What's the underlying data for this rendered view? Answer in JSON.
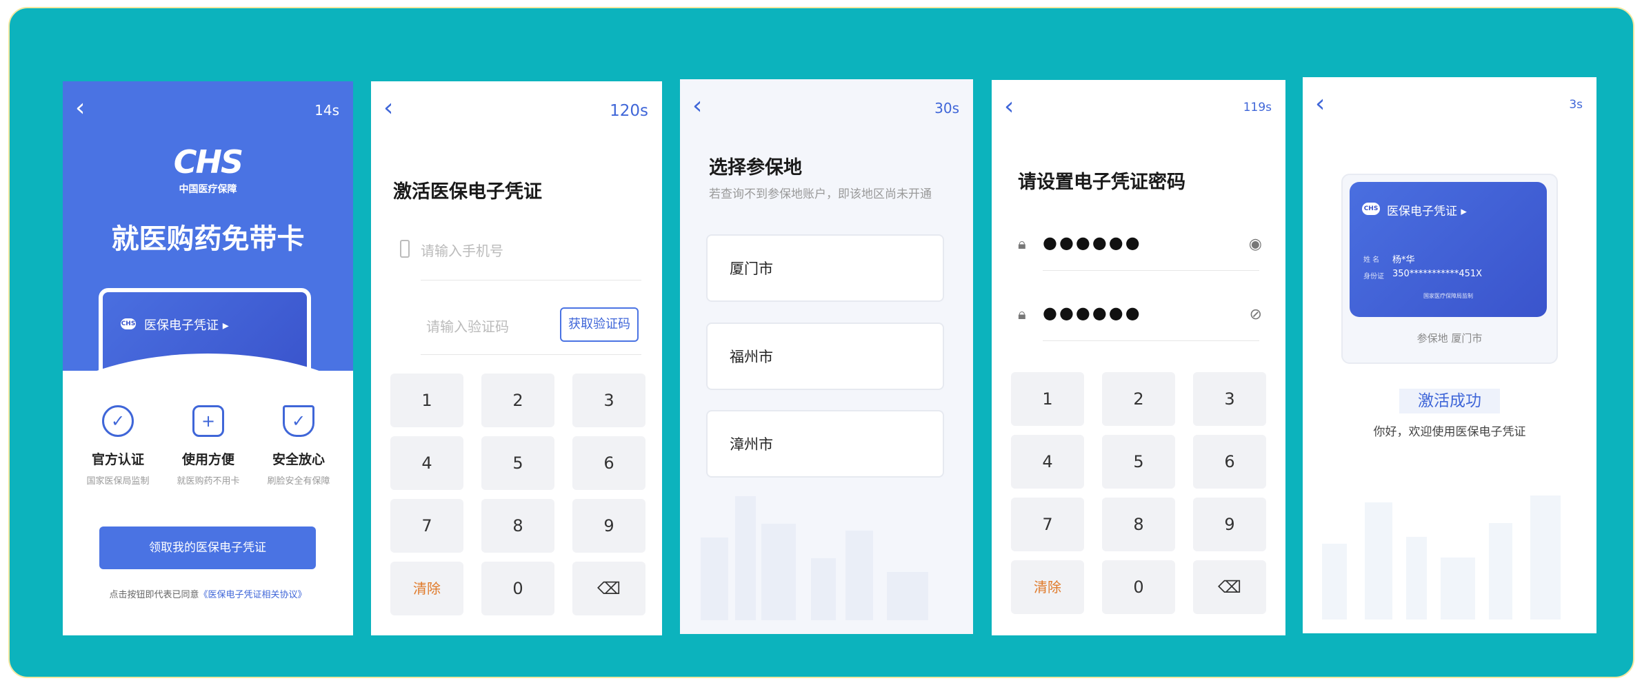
{
  "s1": {
    "timer": "14s",
    "logo_big": "CHS",
    "logo_small": "中国医疗保障",
    "headline": "就医购药免带卡",
    "card_label": "医保电子凭证 ▸",
    "features": [
      {
        "icon": "badge-icon",
        "title": "官方认证",
        "desc": "国家医保局监制"
      },
      {
        "icon": "medkit-icon",
        "title": "使用方便",
        "desc": "就医购药不用卡"
      },
      {
        "icon": "shield-check-icon",
        "title": "安全放心",
        "desc": "刷脸安全有保障"
      }
    ],
    "button": "领取我的医保电子凭证",
    "agree_prefix": "点击按钮即代表已同意",
    "agree_link": "《医保电子凭证相关协议》"
  },
  "s2": {
    "timer": "120s",
    "title": "激活医保电子凭证",
    "phone_placeholder": "请输入手机号",
    "code_placeholder": "请输入验证码",
    "get_code": "获取验证码",
    "keys": [
      "1",
      "2",
      "3",
      "4",
      "5",
      "6",
      "7",
      "8",
      "9",
      "清除",
      "0",
      "⌫"
    ]
  },
  "s3": {
    "timer": "30s",
    "title": "选择参保地",
    "subtitle": "若查询不到参保地账户，即该地区尚未开通",
    "cities": [
      "厦门市",
      "福州市",
      "漳州市"
    ]
  },
  "s4": {
    "timer": "119s",
    "title": "请设置电子凭证密码",
    "pwd1": "●●●●●●",
    "pwd2": "●●●●●●",
    "keys": [
      "1",
      "2",
      "3",
      "4",
      "5",
      "6",
      "7",
      "8",
      "9",
      "清除",
      "0",
      "⌫"
    ]
  },
  "s5": {
    "timer": "3s",
    "card_title": "医保电子凭证 ▸",
    "name_label": "姓 名",
    "name_value": "杨*华",
    "id_label": "身份证",
    "id_value": "350***********451X",
    "card_footer": "国家医疗保障局监制",
    "insured_place": "参保地 厦门市",
    "success": "激活成功",
    "welcome": "你好，欢迎使用医保电子凭证"
  },
  "colors": {
    "bg": "#0cb3bd",
    "primary": "#4a73e3",
    "clear": "#e07a2a"
  }
}
